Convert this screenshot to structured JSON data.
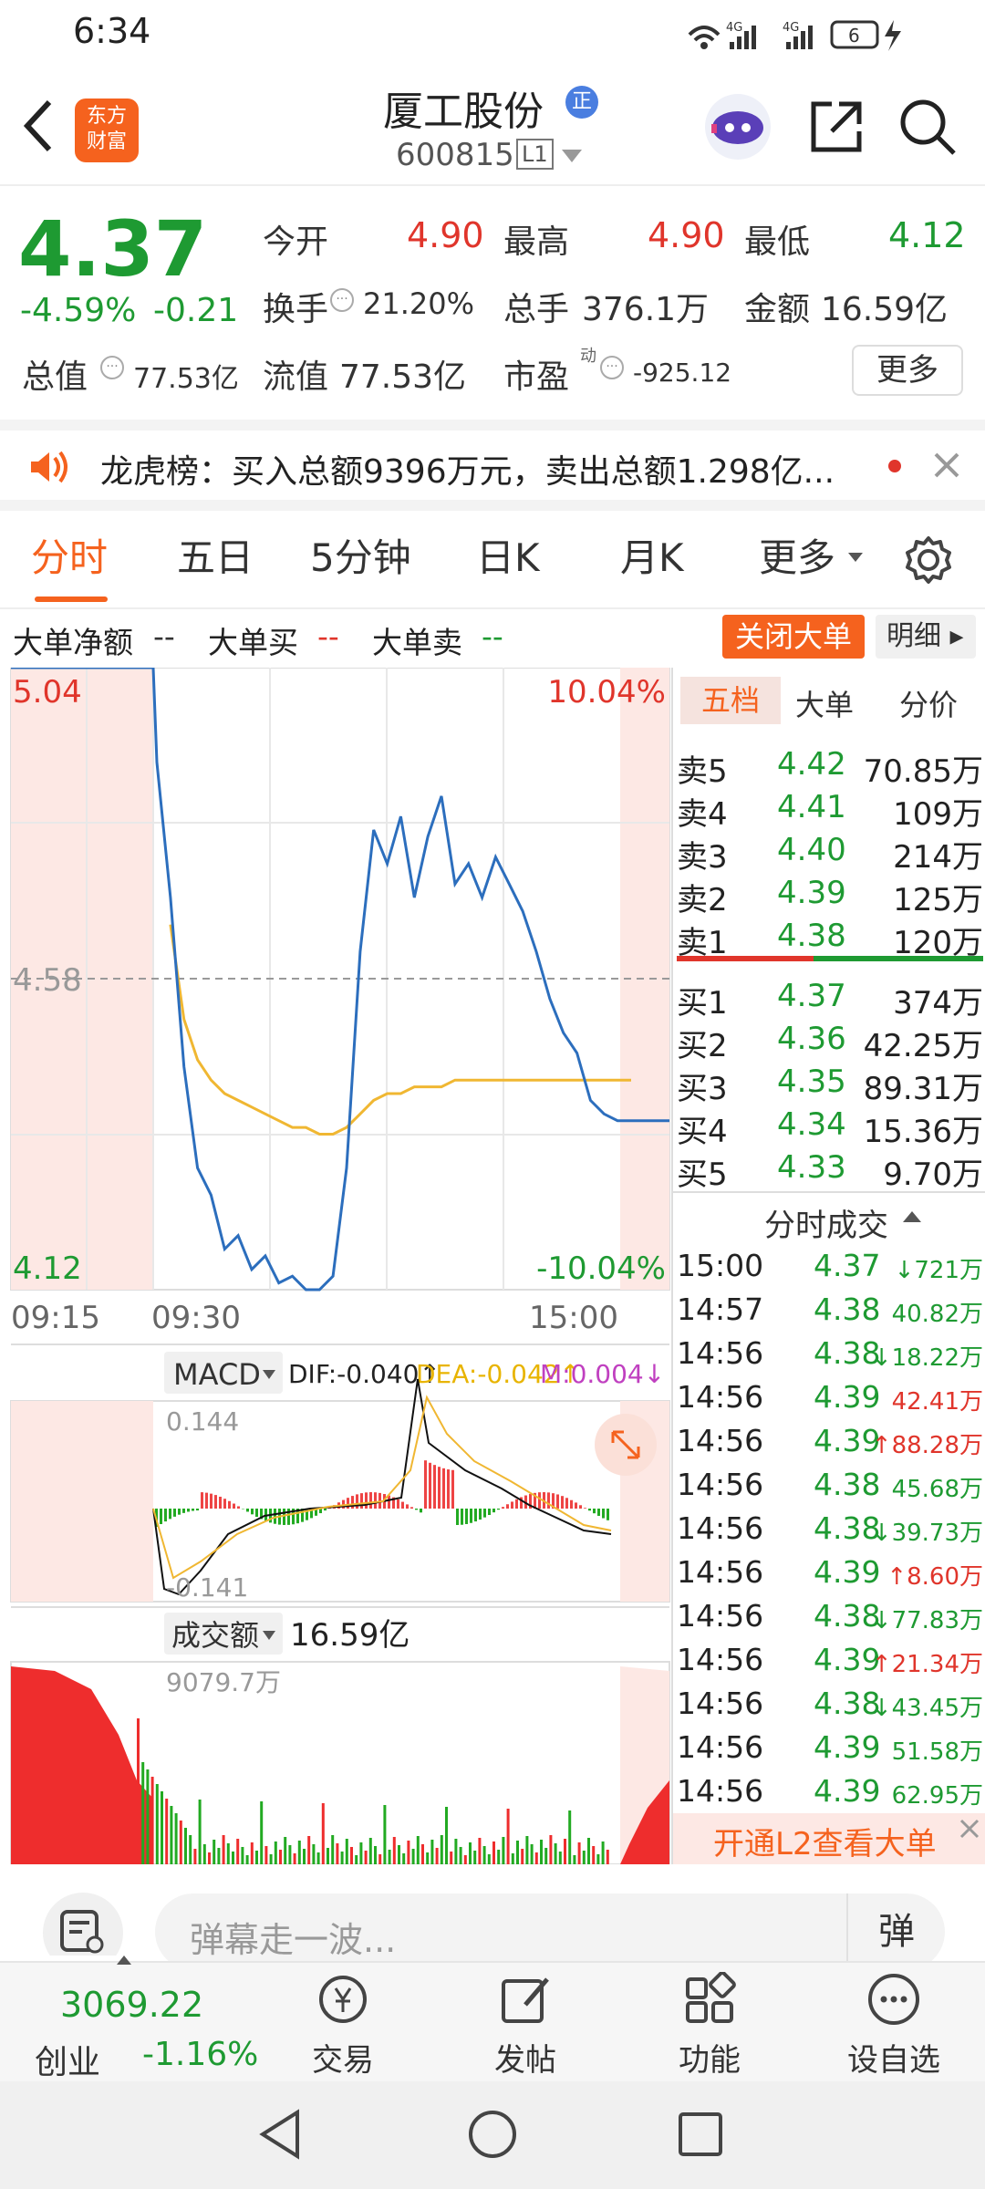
{
  "status_bar": {
    "time": "6:34",
    "net1": "4G",
    "net2": "4G",
    "battery": "6"
  },
  "header": {
    "app_logo": "东方\n财富",
    "title": "厦工股份",
    "title_badge": "正",
    "code": "600815",
    "level": "L1"
  },
  "quote": {
    "price": "4.37",
    "change_pct": "-4.59%",
    "change": "-0.21",
    "open_label": "今开",
    "open": "4.90",
    "high_label": "最高",
    "high": "4.90",
    "low_label": "最低",
    "low": "4.12",
    "turnover_label": "换手",
    "turnover": "21.20%",
    "volume_label": "总手",
    "volume": "376.1万",
    "amount_label": "金额",
    "amount": "16.59亿",
    "mktcap_label": "总值",
    "mktcap": "77.53亿",
    "float_label": "流值",
    "float": "77.53亿",
    "pe_label": "市盈",
    "pe_sup": "动",
    "pe": "-925.12",
    "more_button": "更多"
  },
  "notice": {
    "text": "龙虎榜：买入总额9396万元，卖出总额1.298亿..."
  },
  "tabs": [
    {
      "label": "分时",
      "active": true
    },
    {
      "label": "五日"
    },
    {
      "label": "5分钟"
    },
    {
      "label": "日K"
    },
    {
      "label": "月K"
    },
    {
      "label": "更多"
    }
  ],
  "big_order": {
    "net_label": "大单净额",
    "net_val": "--",
    "buy_label": "大单买",
    "buy_val": "--",
    "sell_label": "大单卖",
    "sell_val": "--",
    "close_button": "关闭大单",
    "detail_button": "明细"
  },
  "chart": {
    "y_top": "5.04",
    "y_mid": "4.58",
    "y_bot": "4.12",
    "pct_top": "10.04%",
    "pct_bot": "-10.04%",
    "t1": "09:15",
    "t2": "09:30",
    "t3": "15:00"
  },
  "macd": {
    "selector": "MACD",
    "dif": "DIF:-0.040↑",
    "dea": "DEA:-0.042↑",
    "m": "M:0.004↓",
    "top": "0.144",
    "bottom": "-0.141"
  },
  "vol": {
    "selector": "成交额",
    "total": "16.59亿",
    "top": "9079.7万"
  },
  "chart_data": {
    "type": "line",
    "xlabel": "",
    "ylabel": "",
    "ylim": [
      4.12,
      5.04
    ],
    "prev_close": 4.58,
    "price": [
      5.04,
      5.04,
      5.04,
      4.9,
      4.7,
      4.45,
      4.3,
      4.26,
      4.18,
      4.2,
      4.15,
      4.17,
      4.13,
      4.14,
      4.12,
      4.12,
      4.14,
      4.3,
      4.62,
      4.8,
      4.75,
      4.82,
      4.7,
      4.79,
      4.85,
      4.72,
      4.75,
      4.7,
      4.76,
      4.72,
      4.68,
      4.62,
      4.55,
      4.5,
      4.47,
      4.4,
      4.38,
      4.37,
      4.37
    ],
    "avg": [
      null,
      null,
      null,
      null,
      4.66,
      4.52,
      4.46,
      4.43,
      4.41,
      4.4,
      4.39,
      4.38,
      4.37,
      4.36,
      4.36,
      4.35,
      4.35,
      4.36,
      4.38,
      4.4,
      4.41,
      4.41,
      4.42,
      4.42,
      4.42,
      4.43,
      4.43,
      4.43,
      4.43,
      4.43,
      4.43,
      4.43,
      4.43,
      4.43,
      4.43,
      4.43,
      4.43,
      4.43,
      4.43
    ]
  },
  "orderbook": {
    "tabs": [
      "五档",
      "大单",
      "分价"
    ],
    "asks": [
      {
        "label": "卖5",
        "price": "4.42",
        "vol": "70.85万"
      },
      {
        "label": "卖4",
        "price": "4.41",
        "vol": "109万"
      },
      {
        "label": "卖3",
        "price": "4.40",
        "vol": "214万"
      },
      {
        "label": "卖2",
        "price": "4.39",
        "vol": "125万"
      },
      {
        "label": "卖1",
        "price": "4.38",
        "vol": "120万"
      }
    ],
    "bids": [
      {
        "label": "买1",
        "price": "4.37",
        "vol": "374万"
      },
      {
        "label": "买2",
        "price": "4.36",
        "vol": "42.25万"
      },
      {
        "label": "买3",
        "price": "4.35",
        "vol": "89.31万"
      },
      {
        "label": "买4",
        "price": "4.34",
        "vol": "15.36万"
      },
      {
        "label": "买5",
        "price": "4.33",
        "vol": "9.70万"
      }
    ]
  },
  "trades": {
    "title": "分时成交",
    "rows": [
      {
        "t": "15:00",
        "p": "4.37",
        "d": "↓",
        "v": "721万",
        "c": "green"
      },
      {
        "t": "14:57",
        "p": "4.38",
        "d": "",
        "v": "40.82万",
        "c": "green"
      },
      {
        "t": "14:56",
        "p": "4.38",
        "d": "↓",
        "v": "18.22万",
        "c": "green"
      },
      {
        "t": "14:56",
        "p": "4.39",
        "d": "",
        "v": "42.41万",
        "c": "red"
      },
      {
        "t": "14:56",
        "p": "4.39",
        "d": "↑",
        "v": "88.28万",
        "c": "red"
      },
      {
        "t": "14:56",
        "p": "4.38",
        "d": "",
        "v": "45.68万",
        "c": "green"
      },
      {
        "t": "14:56",
        "p": "4.38",
        "d": "↓",
        "v": "39.73万",
        "c": "green"
      },
      {
        "t": "14:56",
        "p": "4.39",
        "d": "↑",
        "v": "8.60万",
        "c": "red"
      },
      {
        "t": "14:56",
        "p": "4.38",
        "d": "↓",
        "v": "77.83万",
        "c": "green"
      },
      {
        "t": "14:56",
        "p": "4.39",
        "d": "↑",
        "v": "21.34万",
        "c": "red"
      },
      {
        "t": "14:56",
        "p": "4.38",
        "d": "↓",
        "v": "43.45万",
        "c": "green"
      },
      {
        "t": "14:56",
        "p": "4.39",
        "d": "",
        "v": "51.58万",
        "c": "green"
      },
      {
        "t": "14:56",
        "p": "4.39",
        "d": "",
        "v": "62.95万",
        "c": "green"
      }
    ],
    "l2_banner": "开通L2查看大单"
  },
  "danmu": {
    "placeholder": "弹幕走一波...",
    "button": "弹"
  },
  "bottom_nav": {
    "index_value": "3069.22",
    "index_name": "创业",
    "index_change": "-1.16%",
    "items": [
      {
        "label": "交易",
        "icon": "yen-icon"
      },
      {
        "label": "发帖",
        "icon": "edit-icon"
      },
      {
        "label": "功能",
        "icon": "grid-icon"
      },
      {
        "label": "设自选",
        "icon": "more-icon"
      }
    ]
  },
  "colors": {
    "red": "#e0352b",
    "green": "#1e9a32",
    "blue": "#2c6ebd",
    "yellow": "#f0b732",
    "orange": "#f5621e"
  }
}
